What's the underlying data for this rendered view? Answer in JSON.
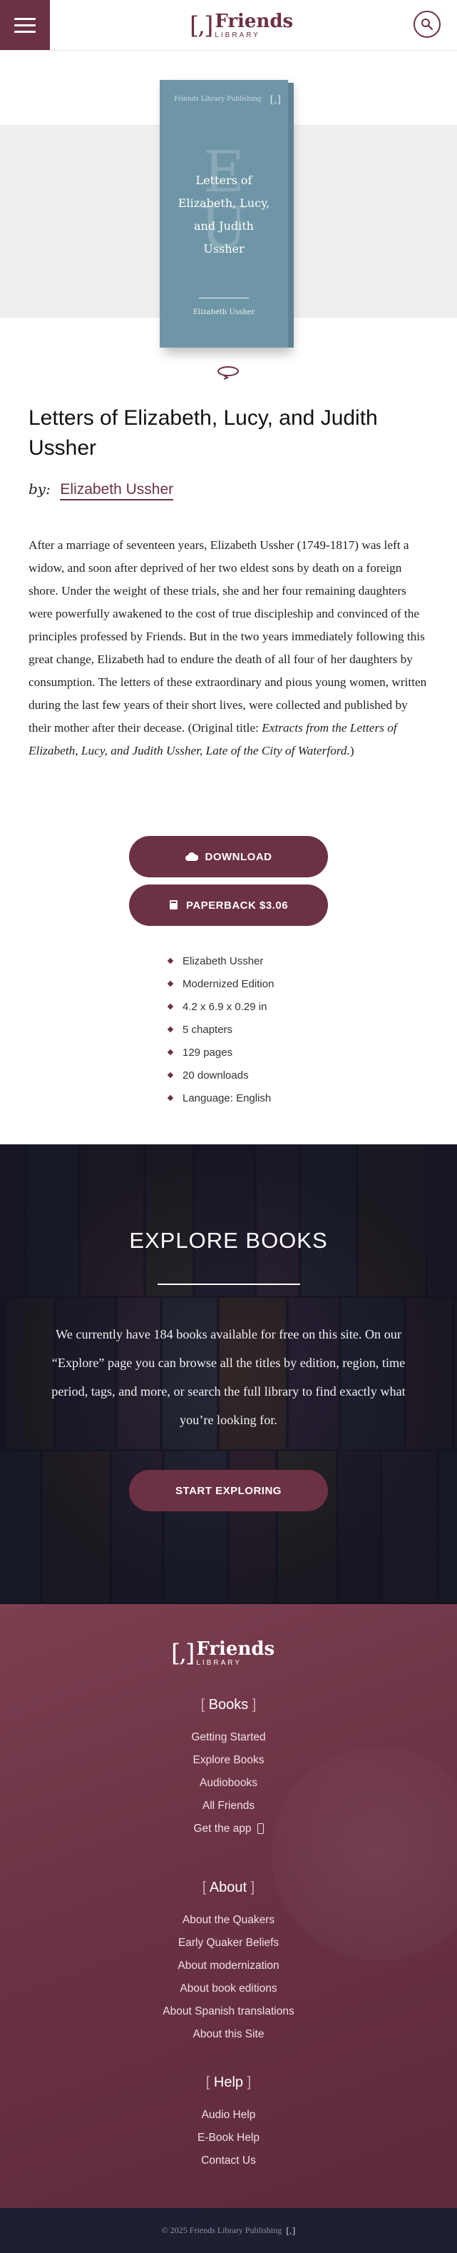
{
  "header": {
    "menu_icon": "hamburger-menu-icon",
    "logo_mark": "[,]",
    "logo_name": "Friends",
    "logo_sub": "LIBRARY",
    "search_icon": "search-icon",
    "brand_color": "#6c3142"
  },
  "book": {
    "cover": {
      "publisher": "Friends Library Publishing",
      "mark": "[,]",
      "initials": "E U",
      "title_lines": [
        "Letters of",
        "Elizabeth, Lucy,",
        "and Judith",
        "Ussher"
      ],
      "author": "Elizabeth Ussher",
      "color": "#6f96a6"
    },
    "rotate_icon": "rotate-3d-icon",
    "title": "Letters of Elizabeth, Lucy, and Judith Ussher",
    "by_label": "by:",
    "author": "Elizabeth Ussher",
    "description_main": "After a marriage of seventeen years, Elizabeth Ussher (1749-1817) was left a widow, and soon after deprived of her two eldest sons by death on a foreign shore. Under the weight of these trials, she and her four remaining daughters were powerfully awakened to the cost of true discipleship and convinced of the principles professed by Friends. But in the two years immediately following this great change, Elizabeth had to endure the death of all four of her daughters by consumption. The letters of these extraordinary and pious young women, written during the last few years of their short lives, were collected and published by their mother after their decease. (Original title: ",
    "description_italic": "Extracts from the Letters of Elizabeth, Lucy, and Judith Ussher, Late of the City of Waterford.",
    "description_end": ")",
    "download_label": "DOWNLOAD",
    "download_icon": "cloud-download-icon",
    "paperback_label": "PAPERBACK $3.06",
    "paperback_icon": "book-icon",
    "meta": [
      "Elizabeth Ussher",
      "Modernized Edition",
      "4.2 x 6.9 x 0.29 in",
      "5 chapters",
      "129 pages",
      "20 downloads",
      "Language: English"
    ]
  },
  "explore": {
    "title": "EXPLORE BOOKS",
    "text": "We currently have 184 books available for free on this site. On our “Explore” page you can browse all the titles by edition, region, time period, tags, and more, or search the full library to find exactly what you’re looking for.",
    "button": "START EXPLORING"
  },
  "footer": {
    "logo_mark": "[,]",
    "logo_name": "Friends",
    "logo_sub": "LIBRARY",
    "sections": [
      {
        "heading": "Books",
        "links": [
          "Getting Started",
          "Explore Books",
          "Audiobooks",
          "All Friends",
          "Get the app"
        ]
      },
      {
        "heading": "About",
        "links": [
          "About the Quakers",
          "Early Quaker Beliefs",
          "About modernization",
          "About book editions",
          "About Spanish translations",
          "About this Site"
        ]
      },
      {
        "heading": "Help",
        "links": [
          "Audio Help",
          "E-Book Help",
          "Contact Us"
        ]
      }
    ],
    "copyright": "© 2025 Friends Library Publishing",
    "copyright_mark": "[,]"
  }
}
